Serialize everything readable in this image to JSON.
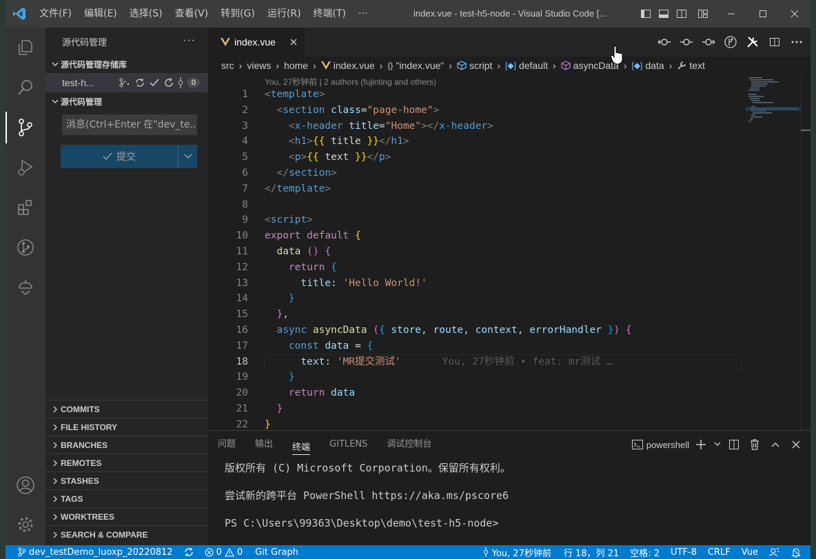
{
  "titlebar": {
    "menu": [
      "文件(F)",
      "编辑(E)",
      "选择(S)",
      "查看(V)",
      "转到(G)",
      "运行(R)",
      "终端(T)",
      "···"
    ],
    "title": "index.vue - test-h5-node - Visual Studio Code [..."
  },
  "sidebar": {
    "title": "源代码管理",
    "more": "···",
    "repos_section": "源代码管理存储库",
    "repo_name": "test-h...",
    "changes_count": "0",
    "scm_section": "源代码管理",
    "message_placeholder": "消息(Ctrl+Enter 在\"dev_te...",
    "commit_label": "提交",
    "panels": [
      "COMMITS",
      "FILE HISTORY",
      "BRANCHES",
      "REMOTES",
      "STASHES",
      "TAGS",
      "WORKTREES",
      "SEARCH & COMPARE"
    ]
  },
  "editor": {
    "tab_label": "index.vue",
    "breadcrumb": [
      "src",
      "views",
      "home",
      "index.vue",
      "\"index.vue\"",
      "script",
      "default",
      "asyncData",
      "data",
      "text"
    ],
    "blame_header": "You, 27秒钟前 | 2 authors (fujinting and others)",
    "current_line": 18,
    "inline_blame": "You, 27秒钟前 • feat: mr测试 …",
    "lines": [
      {
        "n": "1",
        "html": "<span class='tg'>&lt;</span><span class='tn'>template</span><span class='tg'>&gt;</span>"
      },
      {
        "n": "2",
        "html": "  <span class='tg'>&lt;</span><span class='tn'>section</span> <span class='at'>class</span><span class='pl'>=</span><span class='st'>\"page-home\"</span><span class='tg'>&gt;</span>"
      },
      {
        "n": "3",
        "html": "    <span class='tg'>&lt;</span><span class='tn'>x-header</span> <span class='at'>title</span><span class='pl'>=</span><span class='st'>\"Home\"</span><span class='tg'>&gt;&lt;/</span><span class='tn'>x-header</span><span class='tg'>&gt;</span>"
      },
      {
        "n": "4",
        "html": "    <span class='tg'>&lt;</span><span class='tn'>h1</span><span class='tg'>&gt;</span><span class='br1'>{{</span><span class='tx'> title </span><span class='br1'>}}</span><span class='tg'>&lt;/</span><span class='tn'>h1</span><span class='tg'>&gt;</span>"
      },
      {
        "n": "5",
        "html": "    <span class='tg'>&lt;</span><span class='tn'>p</span><span class='tg'>&gt;</span><span class='br1'>{{</span><span class='tx'> text </span><span class='br1'>}}</span><span class='tg'>&lt;/</span><span class='tn'>p</span><span class='tg'>&gt;</span>"
      },
      {
        "n": "6",
        "html": "  <span class='tg'>&lt;/</span><span class='tn'>section</span><span class='tg'>&gt;</span>"
      },
      {
        "n": "7",
        "html": "<span class='tg'>&lt;/</span><span class='tn'>template</span><span class='tg'>&gt;</span>"
      },
      {
        "n": "8",
        "html": ""
      },
      {
        "n": "9",
        "html": "<span class='tg'>&lt;</span><span class='tn'>script</span><span class='tg'>&gt;</span>"
      },
      {
        "n": "10",
        "html": "<span class='ctl'>export</span> <span class='ctl'>default</span> <span class='br1'>{</span>"
      },
      {
        "n": "11",
        "html": "  <span class='fn'>data</span> <span class='br2'>()</span> <span class='br2'>{</span>"
      },
      {
        "n": "12",
        "html": "    <span class='ctl'>return</span> <span class='br3'>{</span>"
      },
      {
        "n": "13",
        "html": "      <span class='vr'>title</span><span class='pl'>:</span> <span class='st'>'Hello World!'</span>"
      },
      {
        "n": "14",
        "html": "    <span class='br3'>}</span>"
      },
      {
        "n": "15",
        "html": "  <span class='br2'>}</span><span class='pl'>,</span>"
      },
      {
        "n": "16",
        "html": "  <span class='kw'>async</span> <span class='fn'>asyncData</span> <span class='br2'>(</span><span class='br3'>{</span> <span class='vr'>store</span><span class='pl'>,</span> <span class='vr'>route</span><span class='pl'>,</span> <span class='vr'>context</span><span class='pl'>,</span> <span class='vr'>errorHandler</span> <span class='br3'>}</span><span class='br2'>)</span> <span class='br2'>{</span>"
      },
      {
        "n": "17",
        "html": "    <span class='kw'>const</span> <span class='vr'>data</span> <span class='pl'>=</span> <span class='br3'>{</span>"
      },
      {
        "n": "18",
        "html": "      <span class='vr'>text</span><span class='pl'>:</span> <span class='st'>'MR提交测试'</span>"
      },
      {
        "n": "19",
        "html": "    <span class='br3'>}</span>"
      },
      {
        "n": "20",
        "html": "    <span class='ctl'>return</span> <span class='vr'>data</span>"
      },
      {
        "n": "21",
        "html": "  <span class='br2'>}</span>"
      },
      {
        "n": "22",
        "html": "<span class='br1'>}</span>"
      }
    ]
  },
  "panel": {
    "tabs": [
      "问题",
      "输出",
      "终端",
      "GITLENS",
      "调试控制台"
    ],
    "active_tab": "终端",
    "shell": "powershell",
    "terminal_lines": [
      "版权所有 (C) Microsoft Corporation。保留所有权利。",
      "尝试新的跨平台 PowerShell https://aka.ms/pscore6",
      "PS C:\\Users\\99363\\Desktop\\demo\\test-h5-node>"
    ]
  },
  "statusbar": {
    "branch": "dev_testDemo_luoxp_20220812",
    "errors": "0",
    "warnings": "0",
    "git_graph": "Git Graph",
    "blame": "You, 27秒钟前",
    "position": "行 18，列 21",
    "spaces": "空格: 2",
    "encoding": "UTF-8",
    "eol": "CRLF",
    "language": "Vue"
  },
  "colors": {
    "accent": "#007acc",
    "vue_green": "#41b883"
  }
}
